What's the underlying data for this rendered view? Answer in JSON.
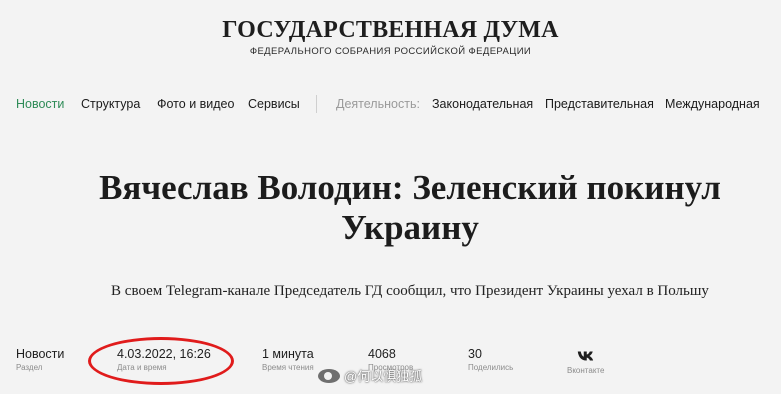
{
  "brand": {
    "title": "ГОСУДАРСТВЕННАЯ ДУМА",
    "subtitle": "ФЕДЕРАЛЬНОГО СОБРАНИЯ РОССИЙСКОЙ ФЕДЕРАЦИИ"
  },
  "nav": {
    "items": [
      "Новости",
      "Структура",
      "Фото и видео",
      "Сервисы"
    ],
    "activity_label": "Деятельность:",
    "activity_items": [
      "Законодательная",
      "Представительная",
      "Международная"
    ],
    "active_color": "#2e8b57"
  },
  "article": {
    "headline_line1": "Вячеслав Володин: Зеленский покинул",
    "headline_line2": "Украину",
    "lead": "В своем Telegram-канале Председатель ГД сообщил, что Президент Украины уехал в Польшу"
  },
  "meta": {
    "section_value": "Новости",
    "section_label": "Раздел",
    "date_value": "4.03.2022, 16:26",
    "date_label": "Дата и время",
    "read_value": "1 минута",
    "read_label": "Время чтения",
    "views_value": "4068",
    "views_label": "Просмотров",
    "shares_value": "30",
    "shares_label": "Поделились",
    "vk_label": "Вконтакте",
    "highlight_color": "#e01b1b"
  },
  "watermark": {
    "text": "@何以惧独孤"
  }
}
